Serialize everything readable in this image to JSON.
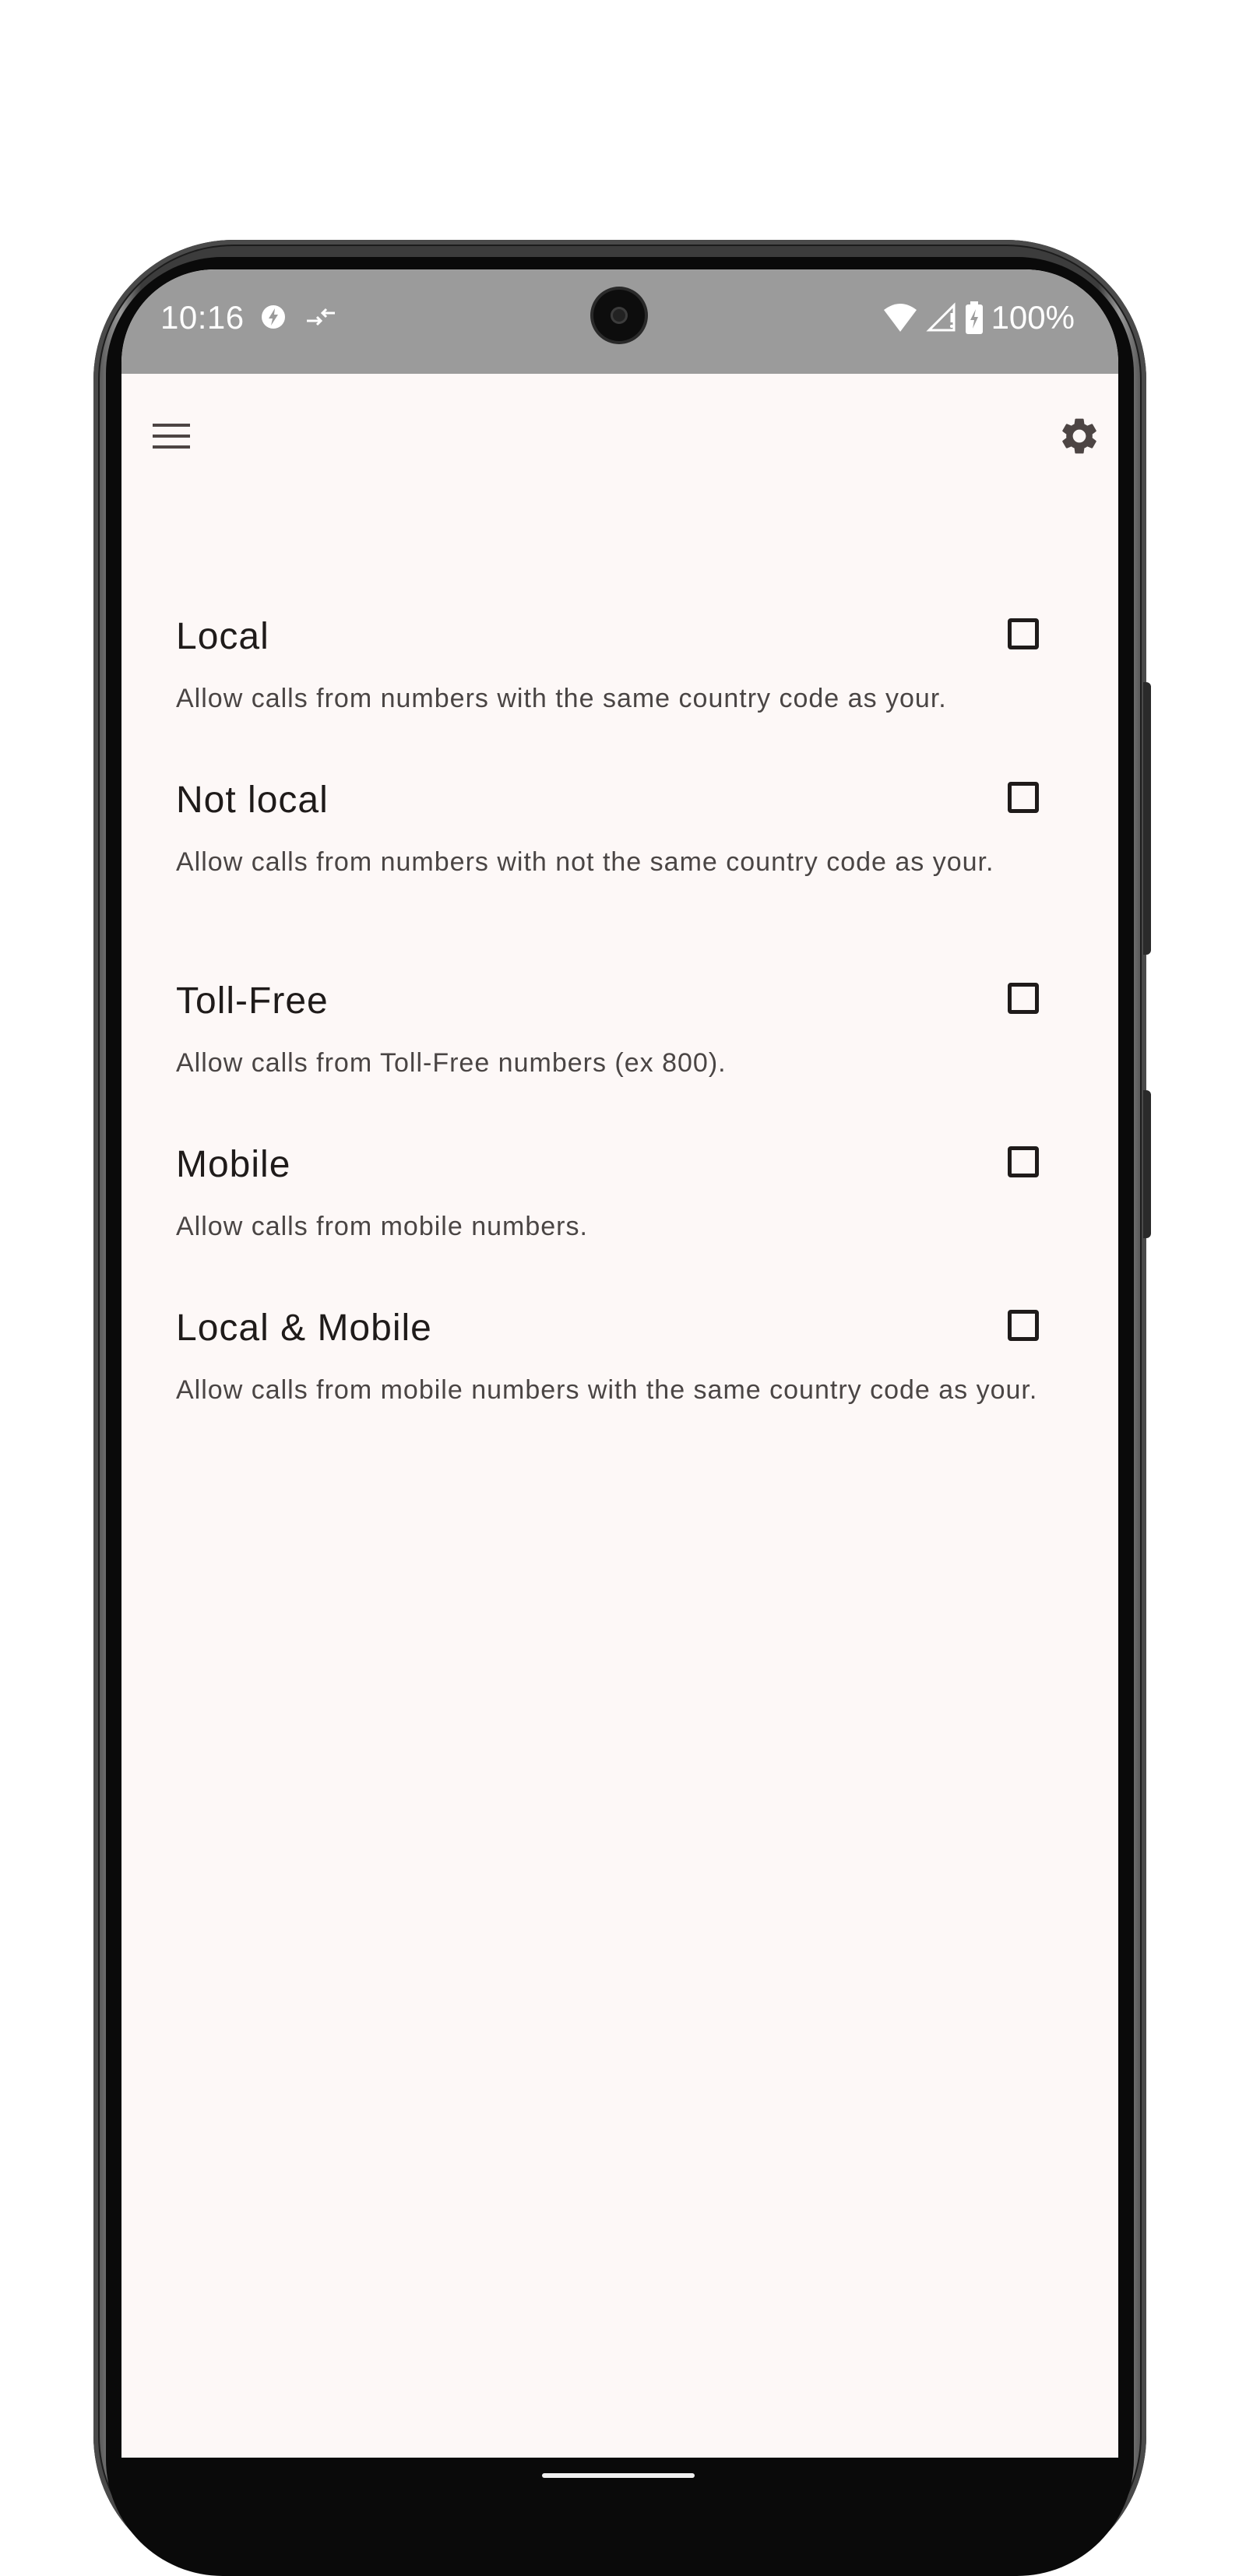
{
  "status_bar": {
    "time": "10:16",
    "battery": "100%",
    "icons": [
      "data-saver-icon",
      "data-transfer-icon",
      "wifi-icon",
      "signal-icon",
      "battery-charging-icon"
    ]
  },
  "app_bar": {
    "menu_icon": "hamburger-menu-icon",
    "settings_icon": "gear-icon"
  },
  "settings": [
    {
      "title": "Local",
      "description": "Allow calls from numbers with the same country code as your.",
      "checked": false
    },
    {
      "title": "Not local",
      "description": "Allow calls from numbers with not the same country code as your.",
      "checked": false
    },
    {
      "title": "Toll-Free",
      "description": "Allow calls from Toll-Free numbers (ex 800).",
      "checked": false
    },
    {
      "title": "Mobile",
      "description": "Allow calls from mobile numbers.",
      "checked": false
    },
    {
      "title": "Local & Mobile",
      "description": "Allow calls from mobile numbers with the same country code as your.",
      "checked": false
    }
  ],
  "colors": {
    "status_bar_bg": "#9b9b9b",
    "screen_bg": "#fdf8f7",
    "text_primary": "#1f1b1a",
    "text_secondary": "#4a4544",
    "icon": "#4d4544"
  }
}
